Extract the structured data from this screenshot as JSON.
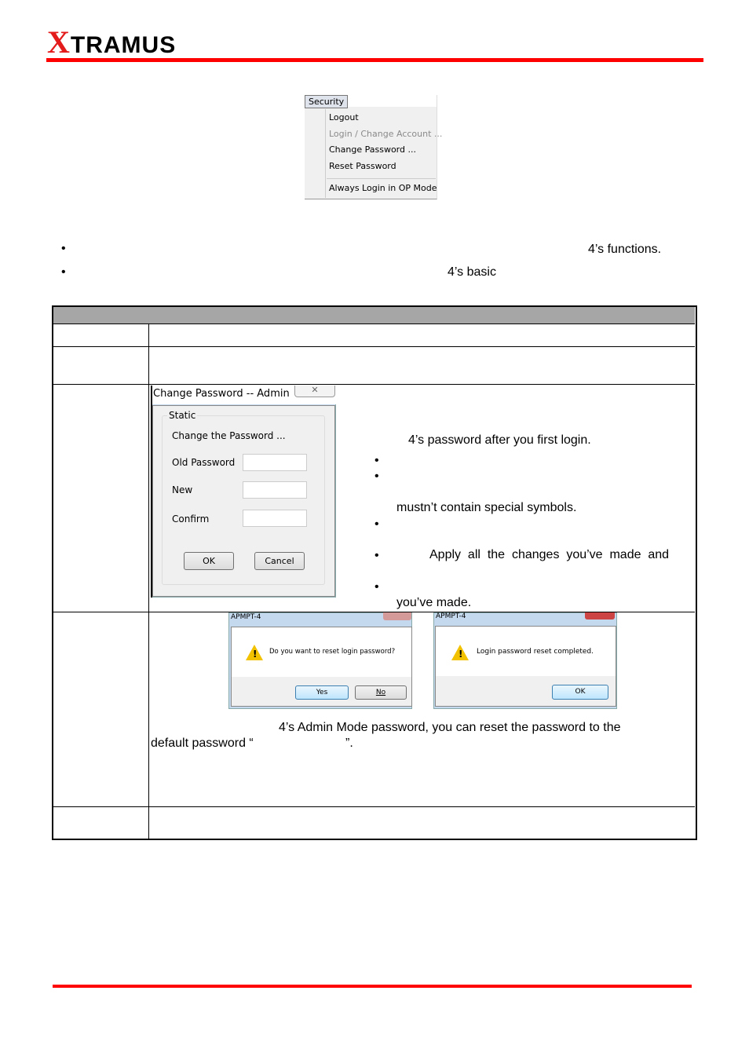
{
  "header": {
    "logo_text": "XTRAMUS",
    "accent": "#ff0000"
  },
  "menu": {
    "title": "Security",
    "items": [
      {
        "label": "Logout",
        "enabled": true
      },
      {
        "label": "Login / Change Account ...",
        "enabled": false
      },
      {
        "label": "Change Password ...",
        "enabled": true
      },
      {
        "label": "Reset Password",
        "enabled": true
      },
      {
        "label": "Always Login in OP Mode",
        "enabled": true
      }
    ]
  },
  "intro": {
    "bullet1_tail": "4’s functions.",
    "bullet2_tail": "4’s basic"
  },
  "change_dialog": {
    "title": "Change Password -- Admin",
    "group": "Static",
    "heading": "Change the Password ...",
    "old_label": "Old Password",
    "new_label": "New",
    "confirm_label": "Confirm",
    "ok": "OK",
    "cancel": "Cancel"
  },
  "change_desc": {
    "line1": "4’s password after you first login.",
    "line2": "mustn’t contain special symbols.",
    "line3": "Apply  all  the  changes  you’ve  made  and",
    "line4": "you’ve made."
  },
  "reset_confirm": {
    "title": "APMPT-4",
    "message": "Do you want to reset login password?",
    "yes": "Yes",
    "no": "No"
  },
  "reset_done": {
    "title": "APMPT-4",
    "message": "Login password reset completed.",
    "ok": "OK"
  },
  "reset_desc": {
    "line1": "4’s Admin Mode password, you can reset the password to the",
    "line2a": "default password “",
    "line2b": "”."
  }
}
